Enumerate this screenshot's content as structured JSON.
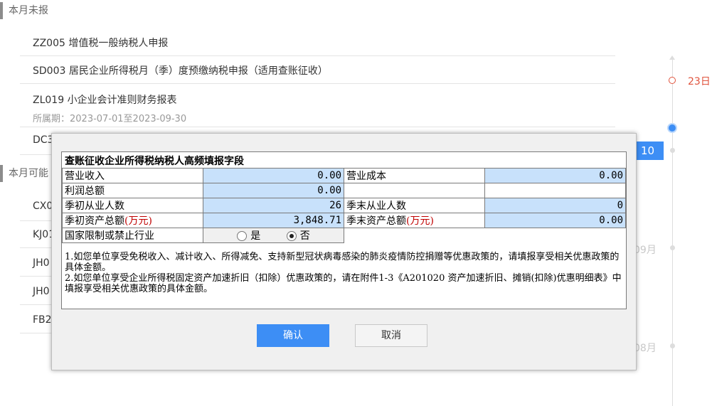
{
  "sections": {
    "unreported": "本月未报",
    "optional": "本月可能"
  },
  "tasks": [
    {
      "title": "ZZ005 增值税一般纳税人申报"
    },
    {
      "title": "SD003 居民企业所得税月（季）度预缴纳税申报（适用查账征收）"
    },
    {
      "title": "ZL019 小企业会计准则财务报表",
      "sub": "所属期：2023-07-01至2023-09-30"
    },
    {
      "title": "DC3"
    }
  ],
  "ghost_items": [
    "CX0",
    "KJ01",
    "JH0",
    "JH0",
    "FB20"
  ],
  "timeline": {
    "day_label": "23日",
    "badge": "10",
    "month_09": "09月",
    "month_08": "08月"
  },
  "modal": {
    "form_title": "查账征收企业所得税纳税人高频填报字段",
    "rows": [
      {
        "label1": "营业收入",
        "value1": "0.00",
        "label2": "营业成本",
        "value2": "0.00"
      },
      {
        "label1": "利润总额",
        "value1": "0.00",
        "label2": "",
        "value2": ""
      },
      {
        "label1": "季初从业人数",
        "value1": "26",
        "label2": "季末从业人数",
        "value2": "0"
      },
      {
        "label1": "季初资产总额",
        "unit1": "(万元)",
        "value1": "3,848.71",
        "label2": "季末资产总额",
        "unit2": "(万元)",
        "value2": "0.00"
      }
    ],
    "restricted_label": "国家限制或禁止行业",
    "radio_yes": "是",
    "radio_no": "否",
    "radio_selected": "否",
    "note1": "1.如您单位享受免税收入、减计收入、所得减免、支持新型冠状病毒感染的肺炎疫情防控捐赠等优惠政策的，请填报享受相关优惠政策的具体金额。",
    "note2": "2.如您单位享受企业所得税固定资产加速折旧（扣除）优惠政策的，请在附件1-3《A201020 资产加速折旧、摊销(扣除)优惠明细表》中填报享受相关优惠政策的具体金额。",
    "ok_label": "确认",
    "cancel_label": "取消"
  },
  "colors": {
    "accent": "#3d8ef5",
    "field_bg": "#c8e1fb",
    "timeline_red": "#e0533d"
  }
}
